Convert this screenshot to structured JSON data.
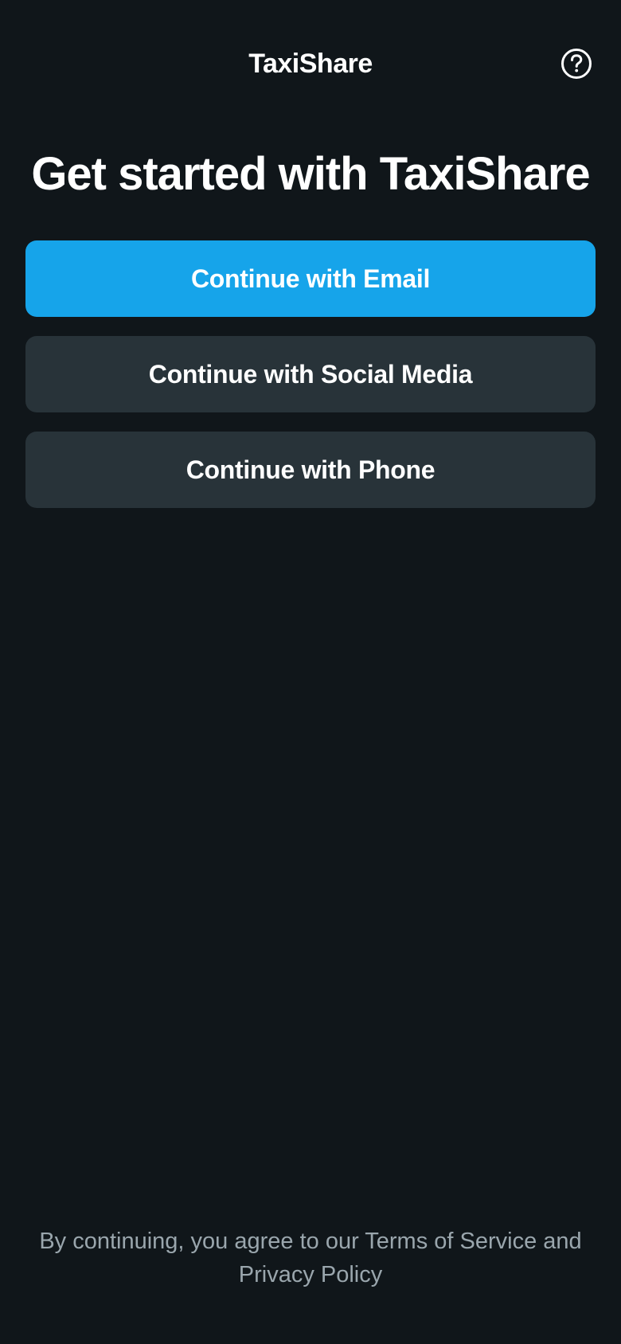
{
  "app": {
    "title": "TaxiShare",
    "help_icon": "help-circle-icon"
  },
  "main": {
    "headline": "Get started with TaxiShare",
    "buttons": {
      "email": "Continue with Email",
      "social": "Continue with Social Media",
      "phone": "Continue with Phone"
    }
  },
  "footer": {
    "line1": "By continuing, you agree to our Terms of Service and",
    "line2": "Privacy Policy"
  },
  "colors": {
    "background": "#10161a",
    "primary": "#16a4ea",
    "secondary": "#283339",
    "footer_text": "#9aa6ad"
  }
}
